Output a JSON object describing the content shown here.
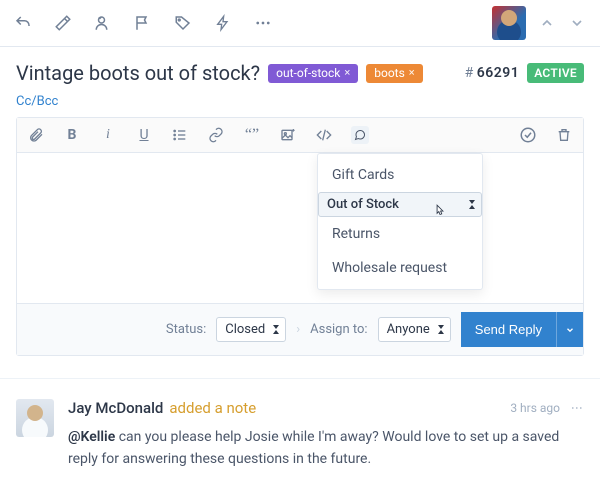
{
  "ticket": {
    "subject": "Vintage boots out of stock?",
    "number_prefix": "#",
    "number": "66291",
    "status_badge": "ACTIVE",
    "tags": [
      {
        "label": "out-of-stock",
        "color": "#805ad5"
      },
      {
        "label": "boots",
        "color": "#ed8936"
      }
    ]
  },
  "ccbcc_label": "Cc/Bcc",
  "editor": {
    "saved_replies": {
      "items": [
        "Gift Cards",
        "Out of Stock",
        "Returns",
        "Wholesale request"
      ],
      "selected_index": 1
    },
    "footer": {
      "status_label": "Status:",
      "status_value": "Closed",
      "assign_label": "Assign to:",
      "assign_value": "Anyone",
      "send_label": "Send Reply"
    }
  },
  "note": {
    "author": "Jay McDonald",
    "action_text": "added a note",
    "timestamp": "3 hrs ago",
    "mention": "@Kellie",
    "body_rest": " can you please help Josie while I'm away? Would love to set up a saved reply for answering these questions in the future."
  }
}
